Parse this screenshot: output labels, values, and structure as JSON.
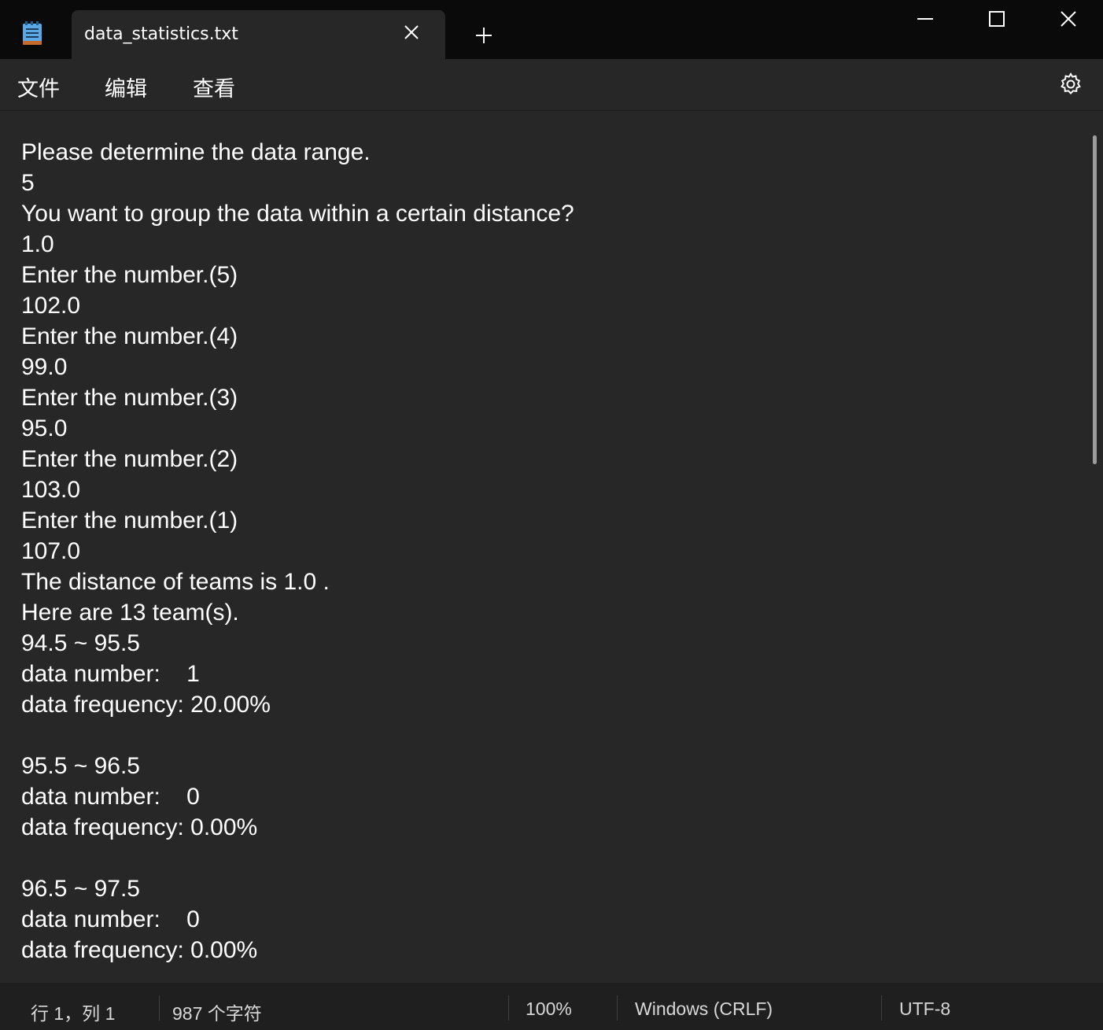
{
  "window": {
    "tab_title": "data_statistics.txt"
  },
  "menu": {
    "file": "文件",
    "edit": "编辑",
    "view": "查看"
  },
  "editor": {
    "content": "Please determine the data range.\n5\nYou want to group the data within a certain distance?\n1.0\nEnter the number.(5)\n102.0\nEnter the number.(4)\n99.0\nEnter the number.(3)\n95.0\nEnter the number.(2)\n103.0\nEnter the number.(1)\n107.0\nThe distance of teams is 1.0 .\nHere are 13 team(s).\n94.5 ~ 95.5\ndata number:    1\ndata frequency: 20.00%\n\n95.5 ~ 96.5\ndata number:    0\ndata frequency: 0.00%\n\n96.5 ~ 97.5\ndata number:    0\ndata frequency: 0.00%"
  },
  "status": {
    "position": "行 1，列 1",
    "char_count": "987 个字符",
    "zoom": "100%",
    "line_ending": "Windows (CRLF)",
    "encoding": "UTF-8"
  },
  "colors": {
    "titlebar_bg": "#0a0a0a",
    "editor_bg": "#272727",
    "statusbar_bg": "#1f1f1f",
    "text": "#ffffff"
  },
  "icons": {
    "app": "notepad-icon",
    "tab_close": "close-icon",
    "new_tab": "plus-icon",
    "minimize": "minimize-icon",
    "maximize": "maximize-icon",
    "close": "close-icon",
    "settings": "gear-icon"
  }
}
